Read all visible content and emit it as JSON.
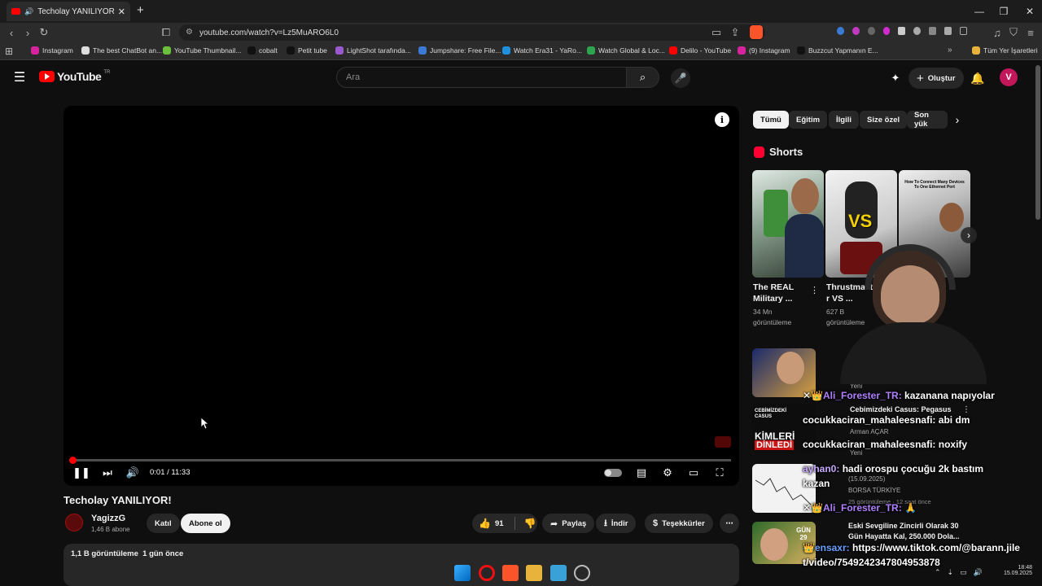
{
  "browser": {
    "tab_title": "Techolay YANILIYOR! - YouTube",
    "url": "youtube.com/watch?v=Lz5MuARO6L0",
    "bookmarks": [
      {
        "label": "Instagram",
        "color": "#d6249f"
      },
      {
        "label": "The best ChatBot an...",
        "color": "#dddddd"
      },
      {
        "label": "YouTube Thumbnail...",
        "color": "#6bbf3a"
      },
      {
        "label": "cobalt",
        "color": "#111111"
      },
      {
        "label": "Petit tube",
        "color": "#111111"
      },
      {
        "label": "LightShot tarafında...",
        "color": "#9b59d0"
      },
      {
        "label": "Jumpshare: Free File...",
        "color": "#3a7bd5"
      },
      {
        "label": "Watch Era31 - YaRo...",
        "color": "#1f8fe0"
      },
      {
        "label": "Watch Global & Loc...",
        "color": "#2ea44f"
      },
      {
        "label": "Delilo - YouTube",
        "color": "#ff0000"
      },
      {
        "label": "(9) Instagram",
        "color": "#d6249f"
      },
      {
        "label": "Buzzcut Yapmanın E...",
        "color": "#111111"
      }
    ],
    "all_bookmarks": "Tüm Yer İşaretleri"
  },
  "youtube": {
    "logo": "YouTube",
    "country": "TR",
    "search_placeholder": "Ara",
    "create_label": "Oluştur",
    "avatar_letter": "V",
    "chips": [
      "Tümü",
      "Eğitim",
      "İlgili",
      "Size özel",
      "Son yük"
    ],
    "shorts_label": "Shorts"
  },
  "video": {
    "title": "Techolay YANILIYOR!",
    "time": "0:01 / 11:33",
    "progress": 0.0014,
    "channel": "YagizzG",
    "subscribers": "1,46 B abone",
    "join_label": "Katıl",
    "subscribe_label": "Abone ol",
    "likes": "91",
    "share_label": "Paylaş",
    "download_label": "İndir",
    "thanks_label": "Teşekkürler",
    "views": "1,1 B görüntüleme",
    "date": "1 gün önce"
  },
  "shorts": [
    {
      "title1": "The REAL",
      "title2": "Military ...",
      "meta1": "34 Mn",
      "meta2": "görüntüleme"
    },
    {
      "title1": "Thrustmaste",
      "title2": "r VS ...",
      "meta1": "627 B",
      "meta2": "görüntüleme"
    },
    {
      "title1": "",
      "title2": "",
      "meta1": "",
      "meta2": ""
    }
  ],
  "related": [
    {
      "title": "Cebimizdeki Casus: Pegasus",
      "channel": "Arman AÇAR",
      "badge": "Yeni",
      "thumb_text1": "CEBİMİZDEKİ",
      "thumb_text2": "CASUS",
      "thumb_text3": "KİMLERİ",
      "thumb_text4": "DİNLEDİ"
    },
    {
      "title": "",
      "channel": "(15.09.2025)",
      "line3": "BORSA TÜRKİYE",
      "badge": "Yeni",
      "views": "25 görüntüleme · 12 saat önce"
    },
    {
      "title": "Eski Sevgiline Zincirli Olarak 30",
      "title2": "Gün Hayatta Kal, 250.000 Dola...",
      "thumb_text": "GÜN 29"
    }
  ],
  "chat": [
    {
      "user": "Ali_Forester_TR:",
      "msg": "kazanana napıyolar"
    },
    {
      "user": "cocukkaciran_mahaleesnafi:",
      "msg": "abi dm"
    },
    {
      "user": "cocukkaciran_mahaleesnafi:",
      "msg": "noxify"
    },
    {
      "user": "ayhan0:",
      "msg": "hadi orospu çocuğu 2k bastım",
      "msg2": "kazan"
    },
    {
      "user": "Ali_Forester_TR:",
      "msg": "🙏"
    },
    {
      "user": "ensaxr:",
      "msg": "https://www.tiktok.com/@barann.jile",
      "msg2": "t/video/7549242347804953878"
    }
  ],
  "taskbar": {
    "time": "18:48",
    "date": "15.09.2025"
  }
}
